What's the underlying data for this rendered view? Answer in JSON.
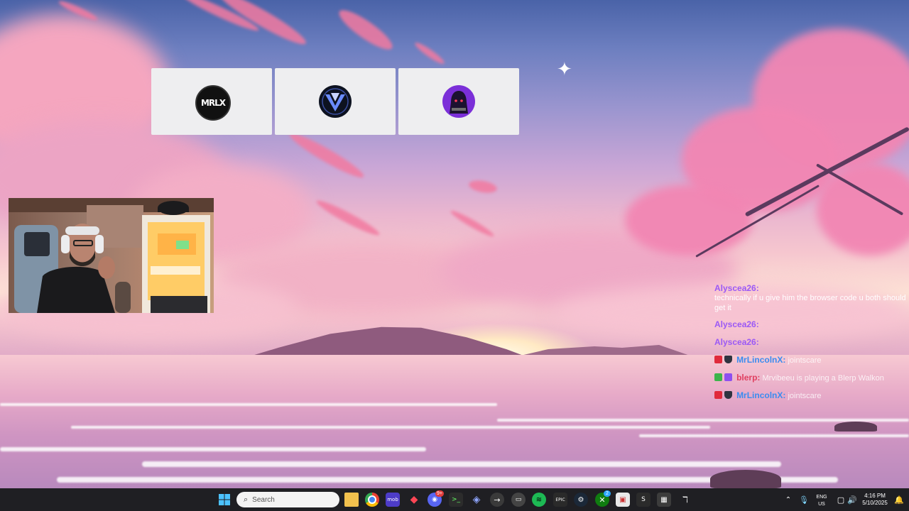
{
  "chat": {
    "messages": [
      {
        "user": "Alyscea26:",
        "text": "technically if u give him the browser code u both should get it",
        "color": "#9b59f5"
      },
      {
        "user": "Alyscea26:",
        "text": "",
        "color": "#9b59f5"
      },
      {
        "user": "Alyscea26:",
        "text": "",
        "color": "#9b59f5"
      },
      {
        "user": "MrLincolnX:",
        "text": "jointscare",
        "color": "#3a8cf0",
        "badges": [
          "red-badge-icon",
          "shield-badge-icon"
        ]
      },
      {
        "user": "blerp:",
        "text": "Mrvibeeu is playing a Blerp Walkon",
        "color": "#e04060",
        "badges": [
          "green-badge-icon",
          "purple-badge-icon"
        ]
      },
      {
        "user": "MrLincolnX:",
        "text": "jointscare",
        "color": "#3a8cf0",
        "badges": [
          "red-badge-icon",
          "shield-badge-icon"
        ]
      }
    ]
  },
  "cards": [
    {
      "icon": "mrlx-logo-icon",
      "label": "MRLX"
    },
    {
      "icon": "lv-logo-icon",
      "label": ""
    },
    {
      "icon": "hooded-figure-logo-icon",
      "label": ""
    }
  ],
  "taskbar": {
    "search_placeholder": "Search",
    "language_top": "ENG",
    "language_bottom": "US",
    "time": "4:16 PM",
    "date": "5/10/2025",
    "discord_badge": "9+",
    "xbox_badge": "2"
  }
}
